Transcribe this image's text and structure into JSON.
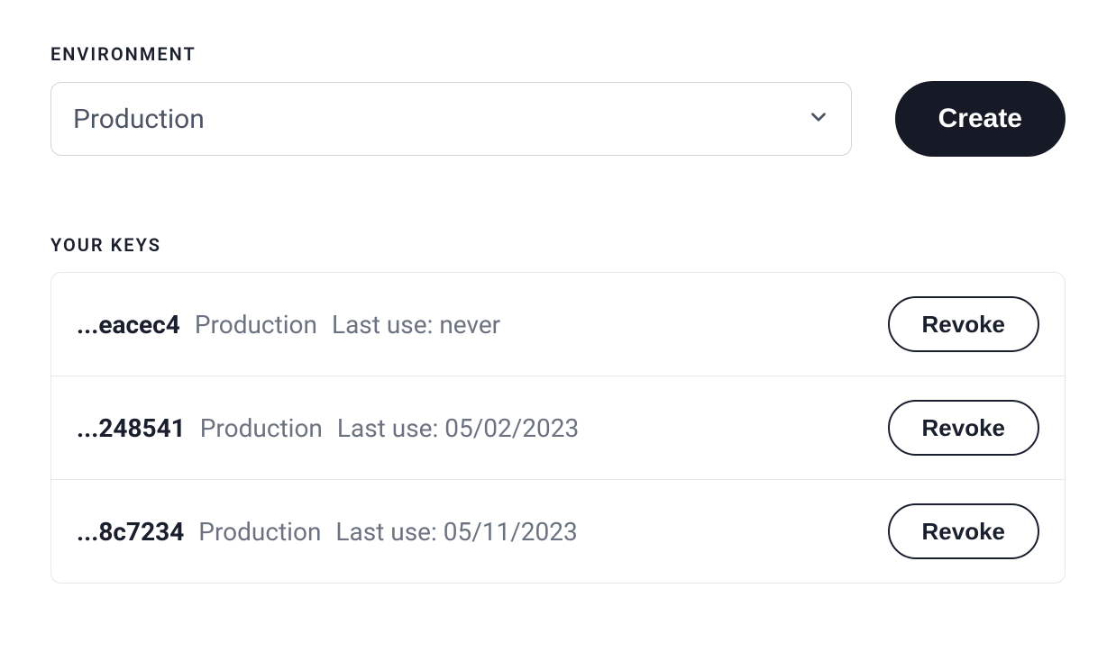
{
  "environment": {
    "label": "ENVIRONMENT",
    "selected": "Production"
  },
  "create_label": "Create",
  "keys_section": {
    "label": "YOUR KEYS"
  },
  "keys": [
    {
      "id": "...eacec4",
      "env": "Production",
      "last_use": "Last use: never",
      "revoke_label": "Revoke"
    },
    {
      "id": "...248541",
      "env": "Production",
      "last_use": "Last use: 05/02/2023",
      "revoke_label": "Revoke"
    },
    {
      "id": "...8c7234",
      "env": "Production",
      "last_use": "Last use: 05/11/2023",
      "revoke_label": "Revoke"
    }
  ]
}
